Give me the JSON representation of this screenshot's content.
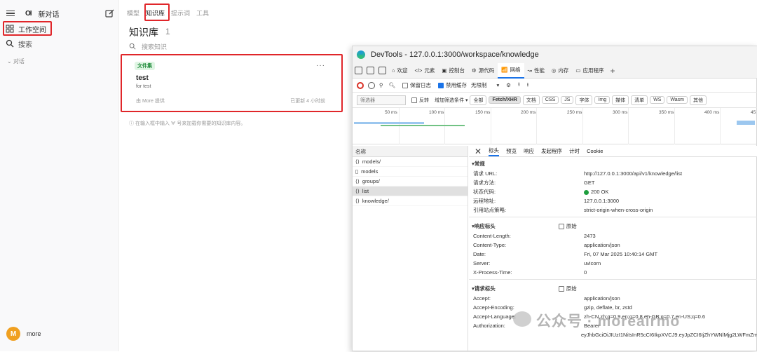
{
  "sidebar": {
    "logo": "OI",
    "new_chat": "新对话",
    "workspace": "工作空间",
    "search": "搜索",
    "section": "对话",
    "user_initial": "M",
    "user_name": "more"
  },
  "tabs": [
    "模型",
    "知识库",
    "提示词",
    "工具"
  ],
  "active_tab_index": 1,
  "page": {
    "title": "知识库",
    "count": "1",
    "search_placeholder": "搜索知识"
  },
  "card": {
    "badge": "文件集",
    "name": "test",
    "description": "for test",
    "provider": "由 More 提供",
    "updated": "已更新 4 小时前",
    "menu": "···"
  },
  "hint": "ⓘ 在输入框中输入 '#' 号来加载你需要的知识库内容。",
  "devtools": {
    "title": "DevTools - 127.0.0.1:3000/workspace/knowledge",
    "tabs": [
      "欢迎",
      "元素",
      "控制台",
      "源代码",
      "网络",
      "性能",
      "内存",
      "应用程序"
    ],
    "active_tab": "网络",
    "toolbar": {
      "preserve_log": "保留日志",
      "disable_cache": "禁用缓存",
      "throttle": "无限制"
    },
    "filter": {
      "placeholder": "筛选器",
      "invert": "反转",
      "more_filters": "增加筛选条件",
      "chips": [
        "全部",
        "Fetch/XHR",
        "文档",
        "CSS",
        "JS",
        "字体",
        "Img",
        "媒体",
        "清单",
        "WS",
        "Wasm",
        "其他"
      ],
      "selected_chip": "Fetch/XHR"
    },
    "timeline_ticks": [
      "50 ms",
      "100 ms",
      "150 ms",
      "200 ms",
      "250 ms",
      "300 ms",
      "350 ms",
      "400 ms",
      "45"
    ],
    "names_header": "名称",
    "requests": [
      "models/",
      "models",
      "groups/",
      "list",
      "knowledge/"
    ],
    "selected_request": "list",
    "detail_tabs": [
      "标头",
      "预览",
      "响应",
      "发起程序",
      "计时",
      "Cookie"
    ],
    "general_title": "常规",
    "general": [
      {
        "k": "请求 URL:",
        "v": "http://127.0.0.1:3000/api/v1/knowledge/list"
      },
      {
        "k": "请求方法:",
        "v": "GET"
      },
      {
        "k": "状态代码:",
        "v": "200 OK"
      },
      {
        "k": "远程地址:",
        "v": "127.0.0.1:3000"
      },
      {
        "k": "引用站点策略:",
        "v": "strict-origin-when-cross-origin"
      }
    ],
    "resp_title": "响应标头",
    "raw_label": "原始",
    "response_headers": [
      {
        "k": "Content-Length:",
        "v": "2473"
      },
      {
        "k": "Content-Type:",
        "v": "application/json"
      },
      {
        "k": "Date:",
        "v": "Fri, 07 Mar 2025 10:40:14 GMT"
      },
      {
        "k": "Server:",
        "v": "uvicorn"
      },
      {
        "k": "X-Process-Time:",
        "v": "0"
      }
    ],
    "req_title": "请求标头",
    "request_headers": [
      {
        "k": "Accept:",
        "v": "application/json"
      },
      {
        "k": "Accept-Encoding:",
        "v": "gzip, deflate, br, zstd"
      },
      {
        "k": "Accept-Language:",
        "v": "zh-CN,zh;q=0.9,en;q=0.8,en-GB;q=0.7,en-US;q=0.6"
      },
      {
        "k": "Authorization:",
        "v": "Bearer"
      },
      {
        "k": "",
        "v": "eyJhbGciOiJIUzI1NiIsInR5cCI6IkpXVCJ9.eyJpZCI6IjZhYWNlMjg2LWFmZm"
      }
    ]
  },
  "watermark": "公众号 · moreairmo"
}
